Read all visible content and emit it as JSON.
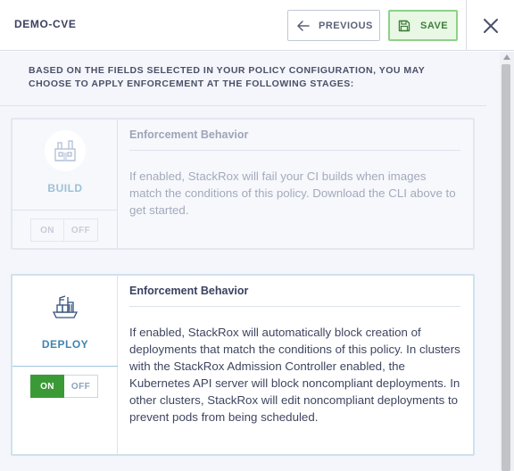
{
  "header": {
    "title": "DEMO-CVE",
    "previous_label": "PREVIOUS",
    "save_label": "SAVE"
  },
  "intro": "BASED ON THE FIELDS SELECTED IN YOUR POLICY CONFIGURATION, YOU MAY CHOOSE TO APPLY ENFORCEMENT AT THE FOLLOWING STAGES:",
  "stages": [
    {
      "label": "BUILD",
      "enabled": false,
      "toggle_on": "ON",
      "toggle_off": "OFF",
      "heading": "Enforcement Behavior",
      "description": "If enabled, StackRox will fail your CI builds when images match the conditions of this policy. Download the CLI above to get started."
    },
    {
      "label": "DEPLOY",
      "enabled": true,
      "toggle_on": "ON",
      "toggle_off": "OFF",
      "heading": "Enforcement Behavior",
      "description": "If enabled, StackRox will automatically block creation of deployments that match the conditions of this policy. In clusters with the StackRox Admission Controller enabled, the Kubernetes API server will block noncompliant deployments. In other clusters, StackRox will edit noncompliant deployments to prevent pods from being scheduled."
    }
  ],
  "icons": {
    "previous": "arrow-left-icon",
    "save": "save-icon",
    "close": "close-icon",
    "build": "factory-icon",
    "deploy": "ship-containers-icon"
  },
  "colors": {
    "accent_blue": "#3f84ad",
    "save_green": "#3f7d3a",
    "on_green": "#3a9b36"
  }
}
